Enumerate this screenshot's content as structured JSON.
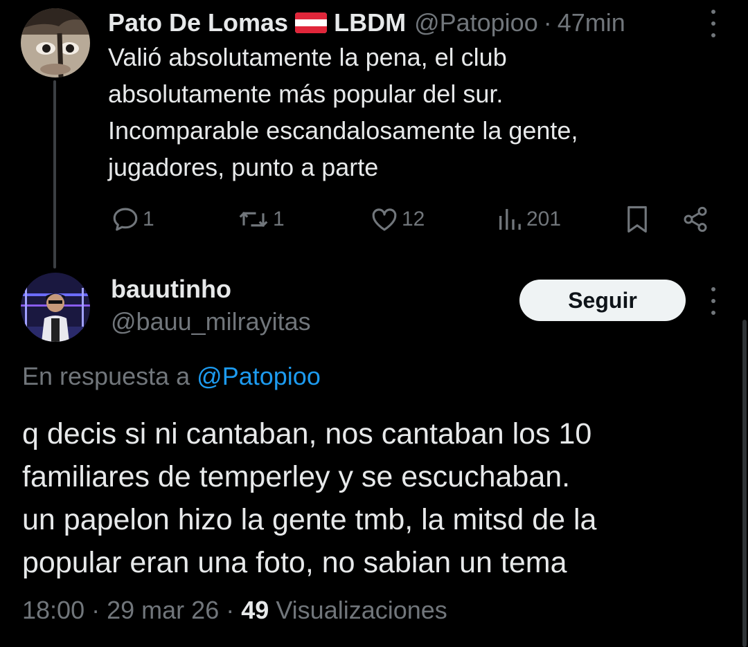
{
  "parent_tweet": {
    "display_name": "Pato De Lomas",
    "flag_emoji": "🇦🇹",
    "name_suffix": "LBDM",
    "handle": "@Patopioo",
    "separator": "·",
    "time_ago": "47min",
    "text": "Valió absolutamente la pena, el club\nabsolutamente más popular del sur.\nIncomparable escandalosamente la gente,\njugadores, punto a parte",
    "actions": {
      "replies": "1",
      "reposts": "1",
      "likes": "12",
      "views": "201"
    }
  },
  "reply_tweet": {
    "display_name": "bauutinho",
    "handle": "@bauu_milrayitas",
    "follow_label": "Seguir",
    "in_reply_prefix": "En respuesta a",
    "in_reply_mention": "@Patopioo",
    "text": "q decis si ni cantaban, nos cantaban los 10\nfamiliares de temperley y se escuchaban.\nun papelon hizo la gente tmb, la mitsd de la\npopular eran una foto, no sabian un tema",
    "time": "18:00",
    "separator": "·",
    "date": "29 mar 26",
    "separator2": "·",
    "views_count": "49",
    "views_label": "Visualizaciones"
  },
  "colors": {
    "background": "#000000",
    "primary_text": "#e7e9ea",
    "secondary_text": "#71767b",
    "link": "#1d9bf0",
    "follow_button_bg": "#eff3f4"
  },
  "icons": {
    "reply": "speech-bubble-icon",
    "repost": "repost-arrows-icon",
    "like": "heart-icon",
    "views": "bar-chart-icon",
    "bookmark": "bookmark-icon",
    "share": "share-nodes-icon",
    "more": "vertical-ellipsis-icon"
  }
}
